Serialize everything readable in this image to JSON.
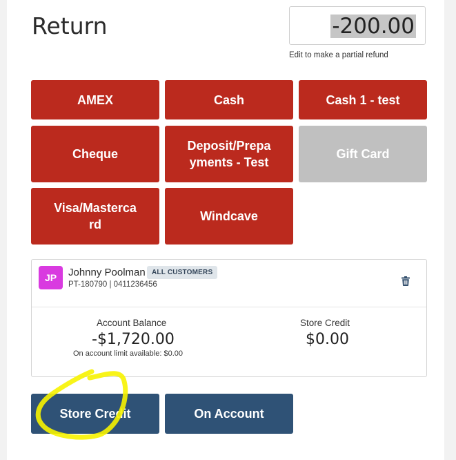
{
  "header": {
    "title": "Return",
    "amount": "-200.00",
    "amount_hint": "Edit to make a partial refund"
  },
  "payment_methods": [
    {
      "label": "AMEX",
      "enabled": true
    },
    {
      "label": "Cash",
      "enabled": true
    },
    {
      "label": "Cash 1 - test",
      "enabled": true
    },
    {
      "label": "Cheque",
      "enabled": true
    },
    {
      "label": "Deposit/Prepa\nyments - Test",
      "enabled": true
    },
    {
      "label": "Gift Card",
      "enabled": false
    },
    {
      "label": "Visa/Masterca\nrd",
      "enabled": true
    },
    {
      "label": "Windcave",
      "enabled": true
    }
  ],
  "customer": {
    "initials": "JP",
    "name": "Johnny Poolman",
    "group": "ALL CUSTOMERS",
    "info": "PT-180790 | 0411236456",
    "account_balance_label": "Account Balance",
    "account_balance": "-$1,720.00",
    "account_limit_note": "On account limit available: $0.00",
    "store_credit_label": "Store Credit",
    "store_credit": "$0.00"
  },
  "actions": {
    "store_credit": "Store Credit",
    "on_account": "On Account"
  },
  "colors": {
    "payment_button": "#bb2a1e",
    "disabled_button": "#c0c0c0",
    "action_button": "#2f5276",
    "avatar": "#d93ae0",
    "highlight_annotation": "#f7f300"
  },
  "icons": {
    "delete": "trash-icon"
  }
}
